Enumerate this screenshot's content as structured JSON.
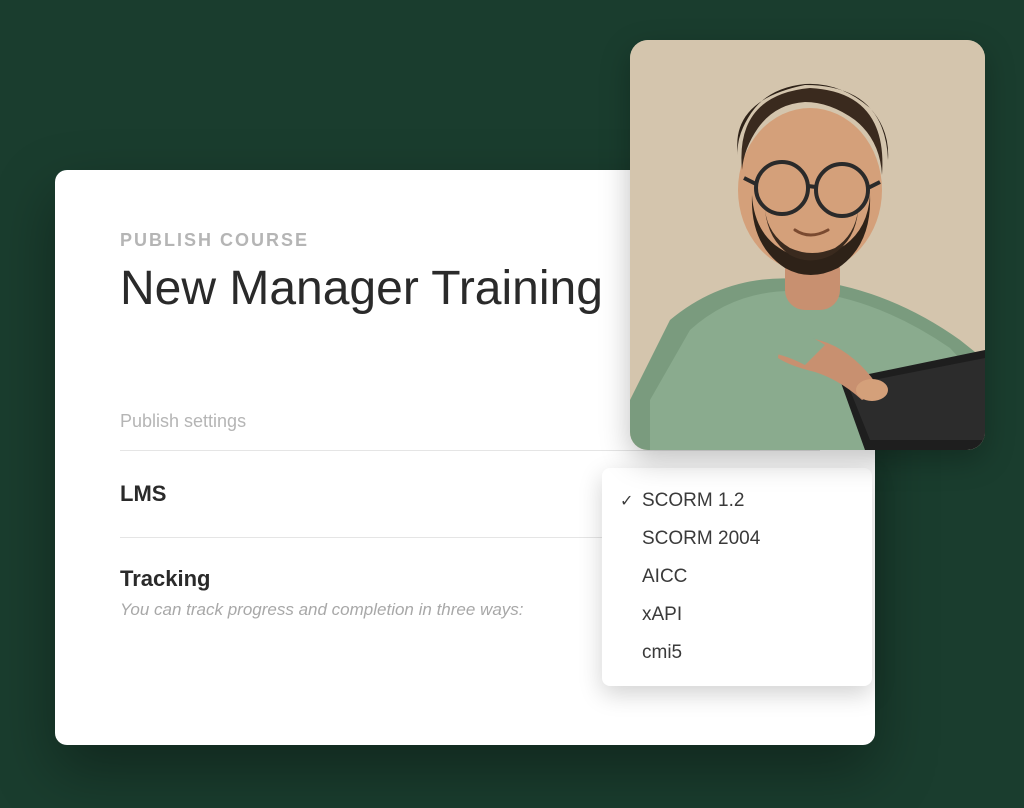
{
  "card": {
    "eyebrow": "PUBLISH COURSE",
    "title": "New Manager Training",
    "settings_label": "Publish settings",
    "lms_label": "LMS",
    "tracking_label": "Tracking",
    "tracking_desc": "You can track progress and completion in three ways:"
  },
  "dropdown": {
    "selected": "SCORM 1.2",
    "options": [
      "SCORM 1.2",
      "SCORM 2004",
      "AICC",
      "xAPI",
      "cmi5"
    ]
  },
  "photo": {
    "alt": "Smiling man with glasses and beard using a laptop"
  }
}
